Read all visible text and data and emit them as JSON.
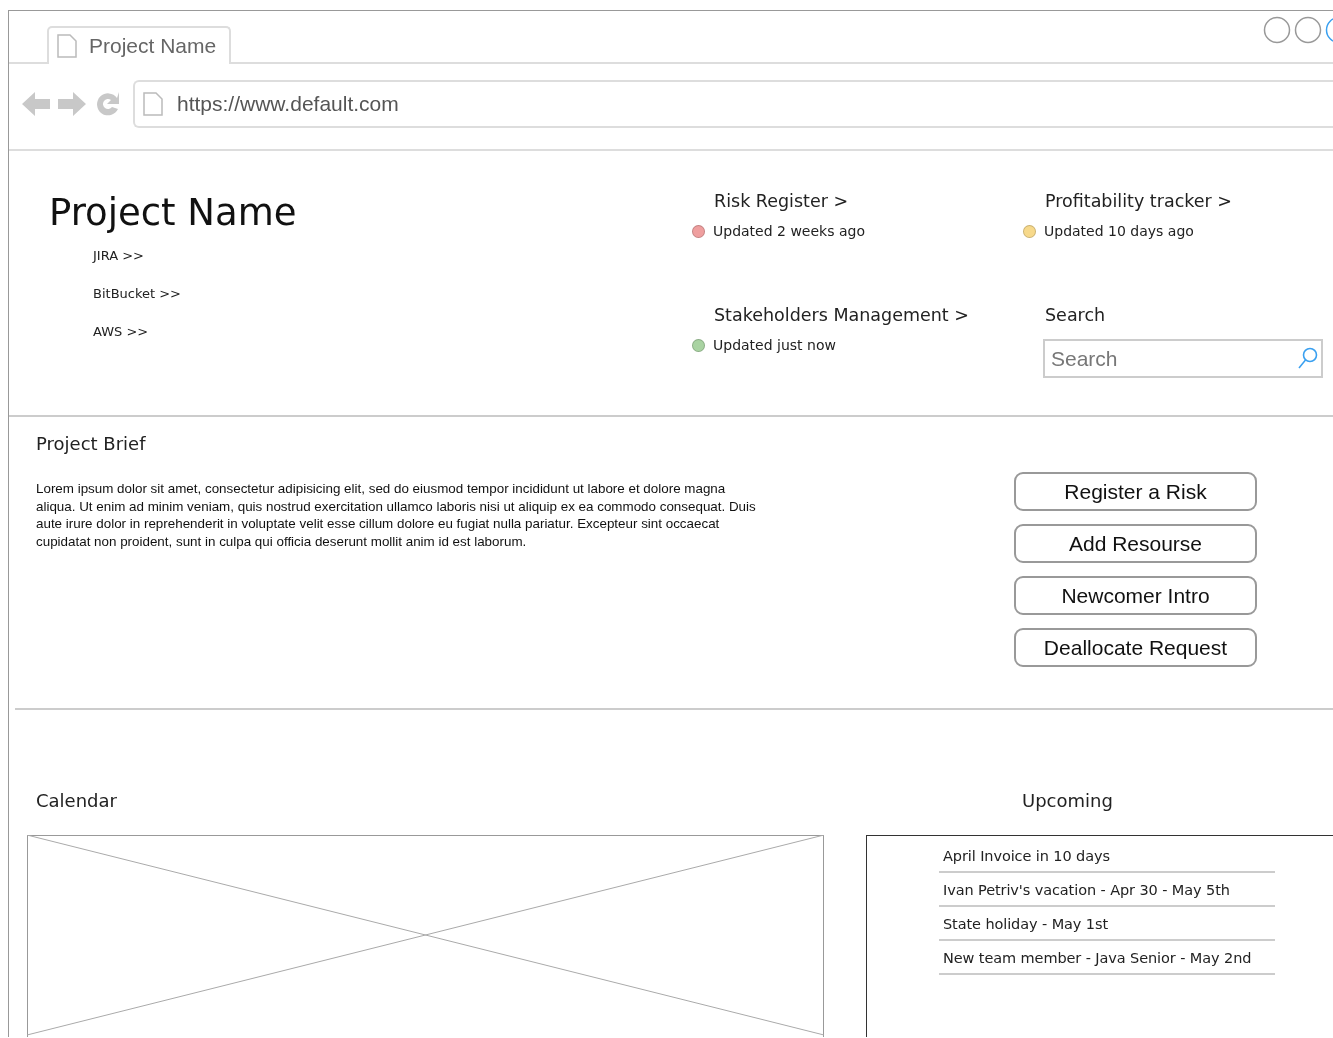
{
  "browser": {
    "tab_title": "Project Name",
    "url": "https://www.default.com"
  },
  "header": {
    "title": "Project Name",
    "links": [
      "JIRA >>",
      "BitBucket >>",
      "AWS >>"
    ]
  },
  "trackers": [
    {
      "title": "Risk Register >",
      "status": "Updated 2 weeks ago",
      "color": "#ef9f9f"
    },
    {
      "title": "Profitability tracker >",
      "status": "Updated 10 days ago",
      "color": "#f7d98b"
    },
    {
      "title": "Stakeholders Management >",
      "status": "Updated just now",
      "color": "#a9d3a2"
    }
  ],
  "search": {
    "label": "Search",
    "placeholder": "Search"
  },
  "brief": {
    "title": "Project Brief",
    "text": "Lorem ipsum dolor sit amet, consectetur adipisicing elit, sed do eiusmod tempor incididunt ut labore et dolore magna aliqua. Ut enim ad minim veniam, quis nostrud exercitation ullamco laboris nisi ut aliquip ex ea commodo consequat. Duis aute irure dolor in reprehenderit in voluptate velit esse cillum dolore eu fugiat nulla pariatur. Excepteur sint occaecat cupidatat non proident, sunt in culpa qui officia deserunt mollit anim id est laborum."
  },
  "actions": [
    "Register a Risk",
    "Add Resourse",
    "Newcomer Intro",
    "Deallocate Request"
  ],
  "calendar": {
    "title": "Calendar"
  },
  "upcoming": {
    "title": "Upcoming",
    "items": [
      "April Invoice in 10 days",
      "Ivan Petriv's vacation - Apr 30 - May 5th",
      "State holiday - May 1st",
      "New team member - Java Senior - May 2nd"
    ]
  }
}
